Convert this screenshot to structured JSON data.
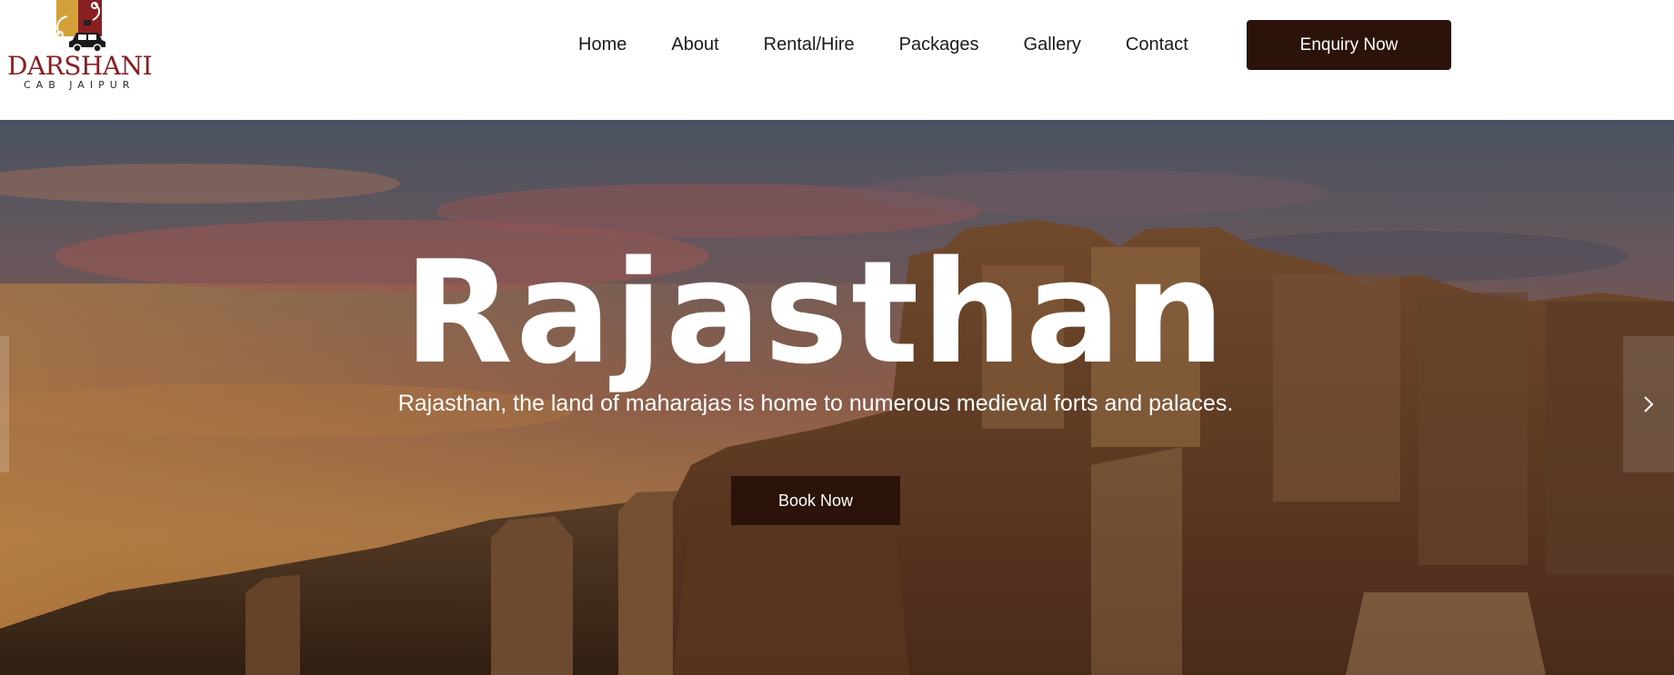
{
  "brand": {
    "name": "DARSHANI",
    "tagline": "CAB JAIPUR",
    "color_primary": "#8a1f22",
    "color_accent": "#d4a03a"
  },
  "nav": {
    "items": [
      {
        "label": "Home"
      },
      {
        "label": "About"
      },
      {
        "label": "Rental/Hire"
      },
      {
        "label": "Packages"
      },
      {
        "label": "Gallery"
      },
      {
        "label": "Contact"
      }
    ],
    "cta_label": "Enquiry Now",
    "cta_color": "#2b130a"
  },
  "hero": {
    "title": "Rajasthan",
    "subtitle": "Rajasthan, the land of maharajas is home to numerous medieval forts and palaces.",
    "button_label": "Book Now",
    "button_color": "#2b130a",
    "prev_icon": "chevron-left-icon",
    "next_icon": "chevron-right-icon"
  }
}
